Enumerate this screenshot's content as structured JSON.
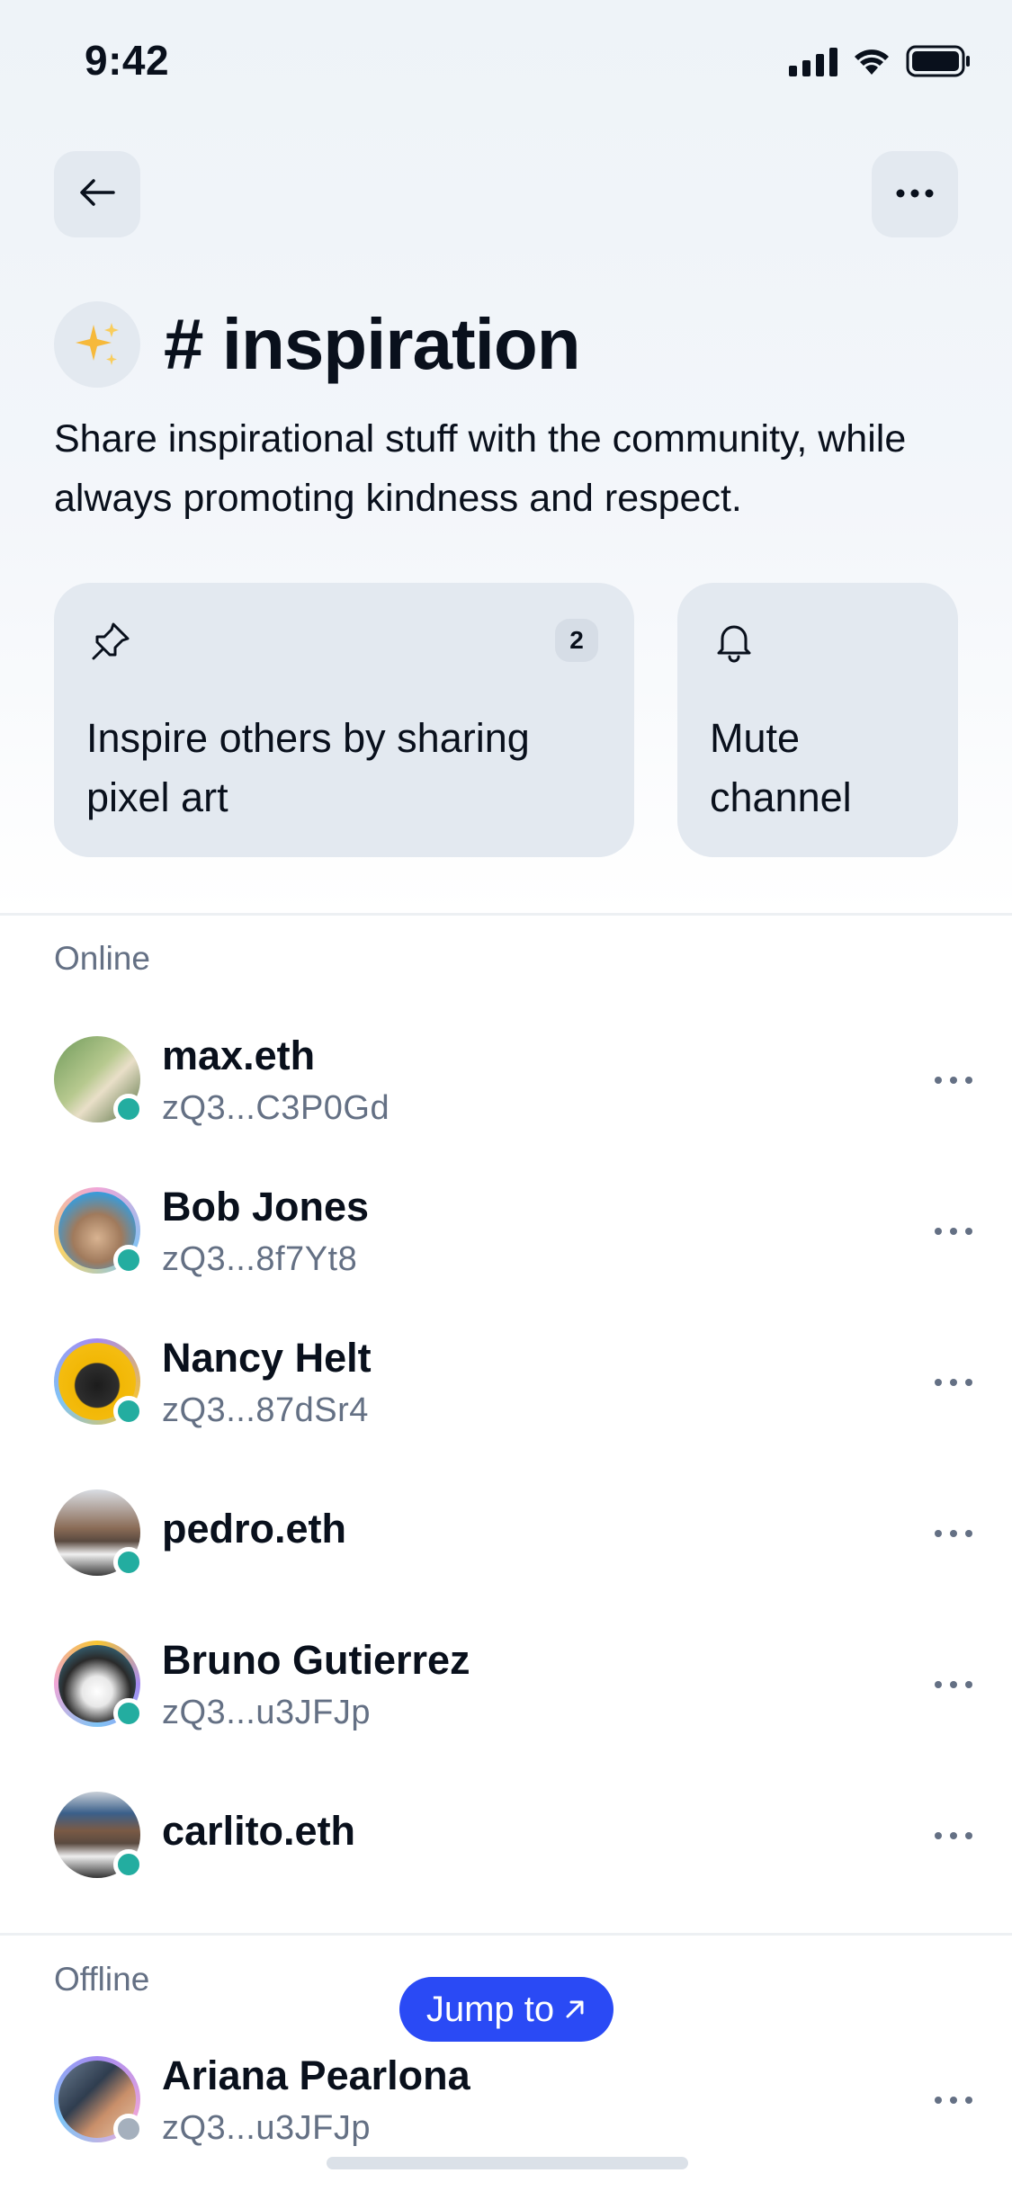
{
  "status_bar": {
    "time": "9:42"
  },
  "channel": {
    "emoji": "✨",
    "title": "# inspiration",
    "description": "Share inspirational stuff with the community, while always promoting kindness and respect."
  },
  "cards": {
    "pinned": {
      "label": "Inspire others by sharing pixel art",
      "count": "2",
      "icon": "pin-icon"
    },
    "mute": {
      "label": "Mute channel",
      "icon": "bell-icon"
    }
  },
  "sections": {
    "online": {
      "label": "Online",
      "members": [
        {
          "name": "max.eth",
          "key": "zQ3...C3P0Gd",
          "status": "online"
        },
        {
          "name": "Bob Jones",
          "key": "zQ3...8f7Yt8",
          "status": "online"
        },
        {
          "name": "Nancy Helt",
          "key": "zQ3...87dSr4",
          "status": "online"
        },
        {
          "name": "pedro.eth",
          "key": "",
          "status": "online"
        },
        {
          "name": "Bruno Gutierrez",
          "key": "zQ3...u3JFJp",
          "status": "online"
        },
        {
          "name": "carlito.eth",
          "key": "",
          "status": "online"
        }
      ]
    },
    "offline": {
      "label": "Offline",
      "members": [
        {
          "name": "Ariana Pearlona",
          "key": "zQ3...u3JFJp",
          "status": "offline"
        }
      ]
    }
  },
  "jump_button": {
    "label": "Jump to",
    "icon": "arrow-up-right-icon"
  },
  "colors": {
    "accent": "#2a4af5",
    "online": "#23ada0",
    "offline": "#a5b0bd",
    "card": "#e3e9f0"
  }
}
